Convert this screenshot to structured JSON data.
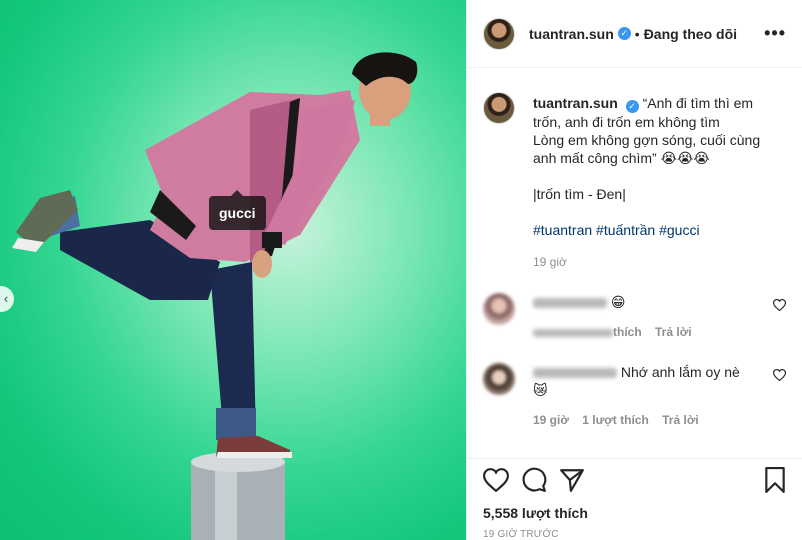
{
  "post": {
    "username": "tuantran.sun",
    "follow_status": "Đang theo dõi",
    "more_label": "•••",
    "photo_tag": "gucci",
    "carousel_prev": "‹"
  },
  "caption": {
    "text_lines": [
      "“Anh đi tìm thì em",
      "trốn, anh đi trốn em không tìm",
      "Lòng em không gợn sóng, cuối cùng",
      "anh mất công chìm” 😭😭😭"
    ],
    "song": "|trốn tìm - Đen|",
    "hashtags": "#tuantran #tuấntrần #gucci",
    "time": "19 giờ"
  },
  "comments": [
    {
      "text": "😁",
      "meta_reply": "Trả lời",
      "meta_like_suffix": "thích"
    },
    {
      "text": "Nhớ anh lắm oy nè",
      "emoji": "😿",
      "time": "19 giờ",
      "likes": "1 lượt thích",
      "reply": "Trả lời"
    }
  ],
  "footer": {
    "likes": "5,558 lượt thích",
    "posted": "19 GIỜ TRƯỚC"
  },
  "icons": [
    "heart-icon",
    "comment-icon",
    "share-icon",
    "bookmark-icon",
    "verified-icon",
    "more-icon"
  ]
}
